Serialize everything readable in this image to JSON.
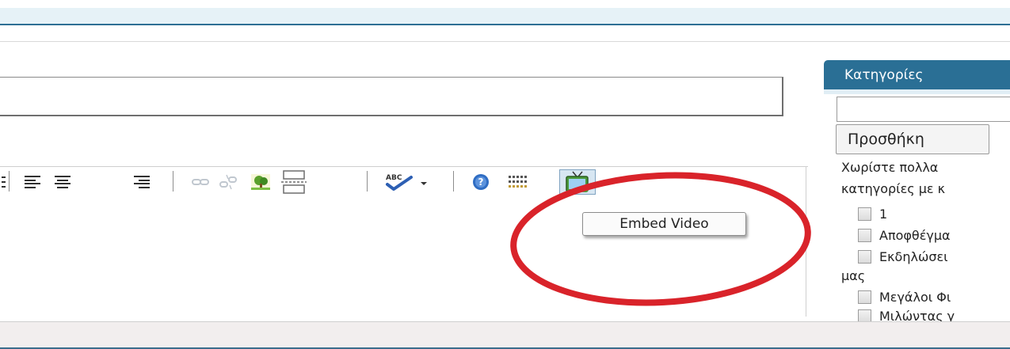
{
  "toolbar": {
    "buttons": [
      {
        "name": "align-left",
        "icon": "align-left-icon"
      },
      {
        "name": "align-center",
        "icon": "align-center-icon"
      },
      {
        "name": "align-right",
        "icon": "align-right-icon"
      },
      {
        "name": "link",
        "icon": "link-icon"
      },
      {
        "name": "unlink",
        "icon": "unlink-icon"
      },
      {
        "name": "insert-image",
        "icon": "image-icon"
      },
      {
        "name": "page-break",
        "icon": "page-break-icon"
      },
      {
        "name": "spellcheck",
        "icon": "spellcheck-icon"
      },
      {
        "name": "help",
        "icon": "help-icon"
      },
      {
        "name": "kitchen-sink",
        "icon": "toolbar-toggle-icon"
      },
      {
        "name": "embed-video",
        "icon": "embed-video-icon"
      }
    ],
    "spellcheck_label": "ABC"
  },
  "tooltip": {
    "text": "Embed Video"
  },
  "categories": {
    "title": "Κατηγορίες",
    "add_button": "Προσθήκη",
    "help_line_1": "Χωρίστε πολλα",
    "help_line_2": "κατηγορίες με κ",
    "items": [
      {
        "label": "1",
        "checked": false
      },
      {
        "label": "Αποφθέγμα",
        "checked": false
      },
      {
        "label": "Εκδηλώσει",
        "checked": false
      },
      {
        "label": "Μεγάλοι Φι",
        "checked": false
      },
      {
        "label": "Μιλώντας γ",
        "checked": false
      }
    ],
    "item_3_continuation": "μας"
  },
  "colors": {
    "accent": "#2a6f95",
    "highlight_ring": "#d9232a",
    "top_bar": "#e6f2f7"
  }
}
